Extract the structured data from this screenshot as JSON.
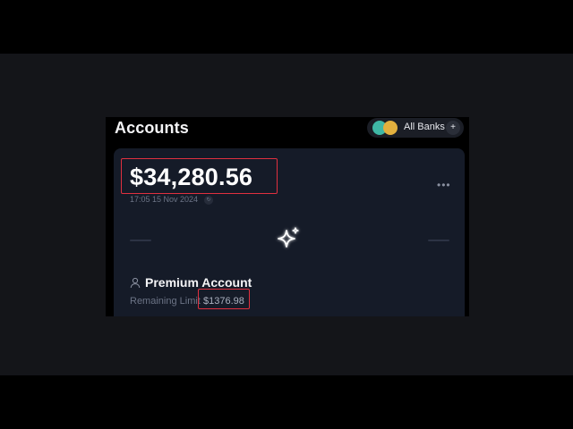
{
  "header": {
    "title": "Accounts"
  },
  "bank_selector": {
    "label": "All Banks",
    "add_label": "+",
    "colors": [
      "#3fb8a6",
      "#e2b03e"
    ]
  },
  "account_card": {
    "balance": "$34,280.56",
    "timestamp": "17:05 15 Nov 2024",
    "more_label": "•••",
    "account_name": "Premium Account",
    "limit_label": "Remaining Limit",
    "limit_value": "$1376.98",
    "highlight_color": "#e0303f",
    "icons": [
      "sparkle-icon",
      "user-icon",
      "more-icon"
    ]
  }
}
